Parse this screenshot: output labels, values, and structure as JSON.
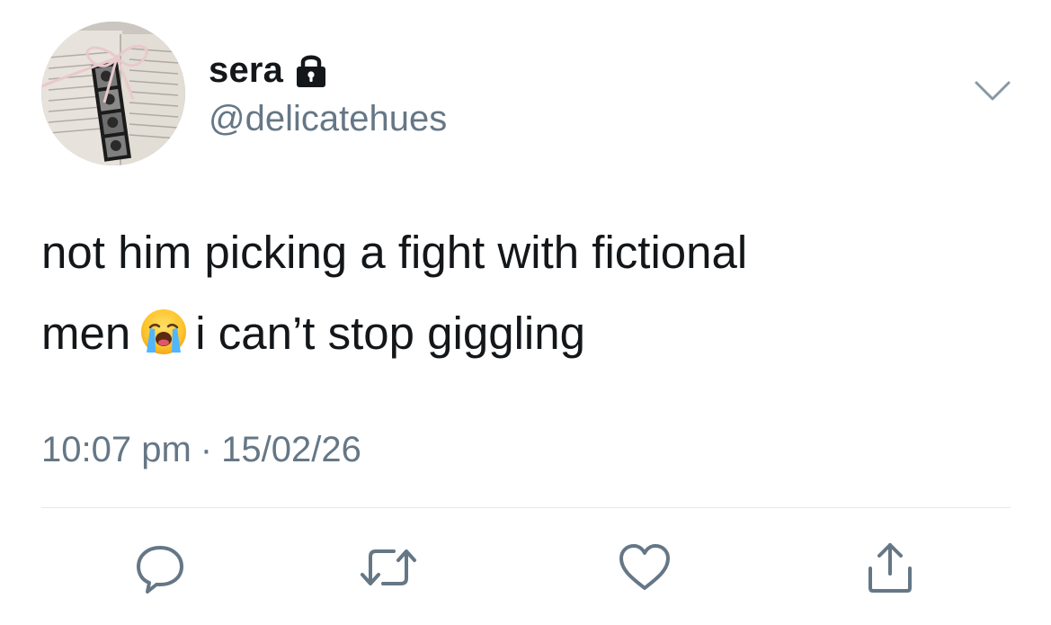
{
  "user": {
    "display_name": "sera",
    "handle": "@delicatehues",
    "protected_icon": "lock-icon",
    "avatar_icon": "avatar"
  },
  "tweet": {
    "line1": "not him picking a fight with fictional",
    "line2_before_emoji": "men",
    "emoji": "loudly-crying-face",
    "line2_after_emoji": "i can’t stop giggling"
  },
  "meta": {
    "time": "10:07 pm",
    "separator": "·",
    "date": "15/02/26"
  },
  "actions": [
    {
      "icon": "reply-icon"
    },
    {
      "icon": "retweet-icon"
    },
    {
      "icon": "like-icon"
    },
    {
      "icon": "share-icon"
    }
  ],
  "menu_icon": "chevron-down-icon",
  "colors": {
    "text_primary": "#14171a",
    "text_secondary": "#657786",
    "divider": "#e1e8ed",
    "icon": "#657786"
  }
}
